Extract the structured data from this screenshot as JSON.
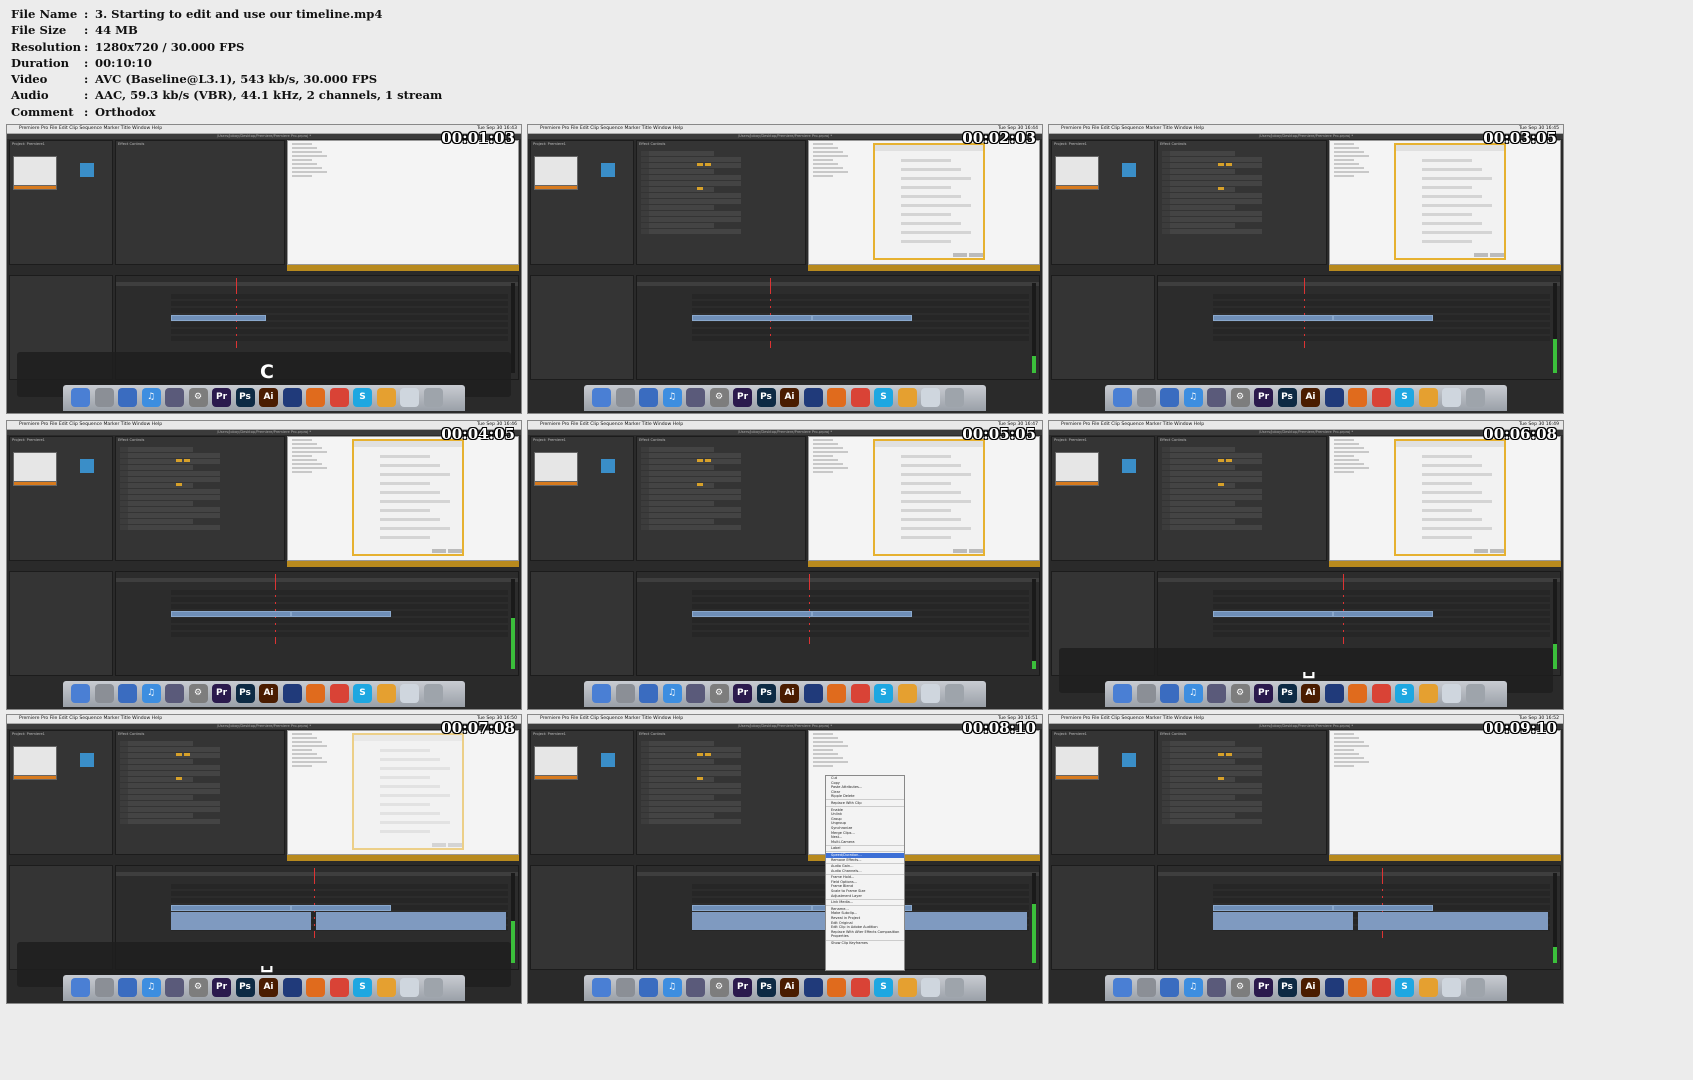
{
  "meta": {
    "rows": [
      {
        "key": "File Name",
        "sep": ":",
        "value": "3. Starting to edit and use our timeline.mp4"
      },
      {
        "key": "File Size",
        "sep": ":",
        "value": "44 MB"
      },
      {
        "key": "Resolution",
        "sep": ":",
        "value": "1280x720 / 30.000 FPS"
      },
      {
        "key": "Duration",
        "sep": ":",
        "value": "00:10:10"
      },
      {
        "key": "Video",
        "sep": ":",
        "value": "AVC (Baseline@L3.1), 543 kb/s, 30.000 FPS"
      },
      {
        "key": "Audio",
        "sep": ":",
        "value": "AAC, 59.3 kb/s (VBR), 44.1 kHz, 2 channels, 1 stream"
      },
      {
        "key": "Comment",
        "sep": ":",
        "value": "Orthodox"
      }
    ]
  },
  "app": {
    "menu": "Premiere Pro   File   Edit   Clip   Sequence   Marker   Title   Window   Help",
    "user": "Jobay Frenkel",
    "window_title": "/Users/Jobay/Desktop/Premiere/Premiere Pro.prproj *",
    "project_tab": "Project: Premiere1",
    "effect_tab": "Effect Controls",
    "program_tab": "Program: Lesson1"
  },
  "thumbs": [
    {
      "ts": "00:01:03",
      "clock": "Tue Sep 30  16:43",
      "caption": "C",
      "variant": "noclip"
    },
    {
      "ts": "00:02:03",
      "clock": "Tue Sep 30  16:44",
      "variant": "dialog"
    },
    {
      "ts": "00:03:05",
      "clock": "Tue Sep 30  16:45",
      "variant": "dialog"
    },
    {
      "ts": "00:04:05",
      "clock": "Tue Sep 30  16:46",
      "variant": "dialog"
    },
    {
      "ts": "00:05:05",
      "clock": "Tue Sep 30  16:47",
      "variant": "dialog"
    },
    {
      "ts": "00:06:08",
      "clock": "Tue Sep 30  16:49",
      "caption": "␣",
      "variant": "dialog"
    },
    {
      "ts": "00:07:08",
      "clock": "Tue Sep 30  16:50",
      "caption": "␣",
      "variant": "dialogdim"
    },
    {
      "ts": "00:08:10",
      "clock": "Tue Sep 30  16:51",
      "variant": "context"
    },
    {
      "ts": "00:09:10",
      "clock": "Tue Sep 30  16:52",
      "variant": "plain"
    }
  ],
  "context_menu": [
    "Cut",
    "Copy",
    "Paste Attributes...",
    "Clear",
    "Ripple Delete",
    "",
    "Replace With Clip",
    "",
    "Enable",
    "Unlink",
    "Group",
    "Ungroup",
    "Synchronize",
    "Merge Clips...",
    "Nest...",
    "Multi-Camera",
    "",
    "Label",
    "",
    "Speed/Duration...",
    "Remove Effects...",
    "",
    "Audio Gain...",
    "Audio Channels...",
    "",
    "Frame Hold...",
    "Field Options...",
    "Frame Blend",
    "Scale to Frame Size",
    "Adjustment Layer",
    "",
    "Link Media...",
    "",
    "Rename...",
    "Make Subclip...",
    "Reveal in Project",
    "Edit Original",
    "Edit Clip in Adobe Audition",
    "Replace With After Effects Composition",
    "Properties",
    "",
    "Show Clip Keyframes"
  ],
  "context_menu_selected": "Speed/Duration...",
  "dock_icons": [
    {
      "name": "finder-icon",
      "label": "",
      "color": "#4a7fd4"
    },
    {
      "name": "launchpad-icon",
      "label": "",
      "color": "#8b8f96"
    },
    {
      "name": "xcode-icon",
      "label": "",
      "color": "#3a6cc0"
    },
    {
      "name": "itunes-icon",
      "label": "♫",
      "color": "#3d8ee0"
    },
    {
      "name": "imovie-icon",
      "label": "",
      "color": "#5a5a7a"
    },
    {
      "name": "preferences-icon",
      "label": "⚙",
      "color": "#7d7d7d"
    },
    {
      "name": "premiere-icon",
      "label": "Pr",
      "color": "#2b1a4d"
    },
    {
      "name": "photoshop-icon",
      "label": "Ps",
      "color": "#0d2a44"
    },
    {
      "name": "illustrator-icon",
      "label": "Ai",
      "color": "#4a1c00"
    },
    {
      "name": "app-stripe-icon",
      "label": "",
      "color": "#203a7a"
    },
    {
      "name": "firefox-icon",
      "label": "",
      "color": "#e06b1d"
    },
    {
      "name": "chrome-icon",
      "label": "",
      "color": "#d94336"
    },
    {
      "name": "skype-icon",
      "label": "S",
      "color": "#1ea7e1"
    },
    {
      "name": "pages-icon",
      "label": "",
      "color": "#e5a030"
    },
    {
      "name": "preview-icon",
      "label": "",
      "color": "#cfd6de"
    },
    {
      "name": "trash-icon",
      "label": "",
      "color": "#9ea4ab"
    }
  ]
}
